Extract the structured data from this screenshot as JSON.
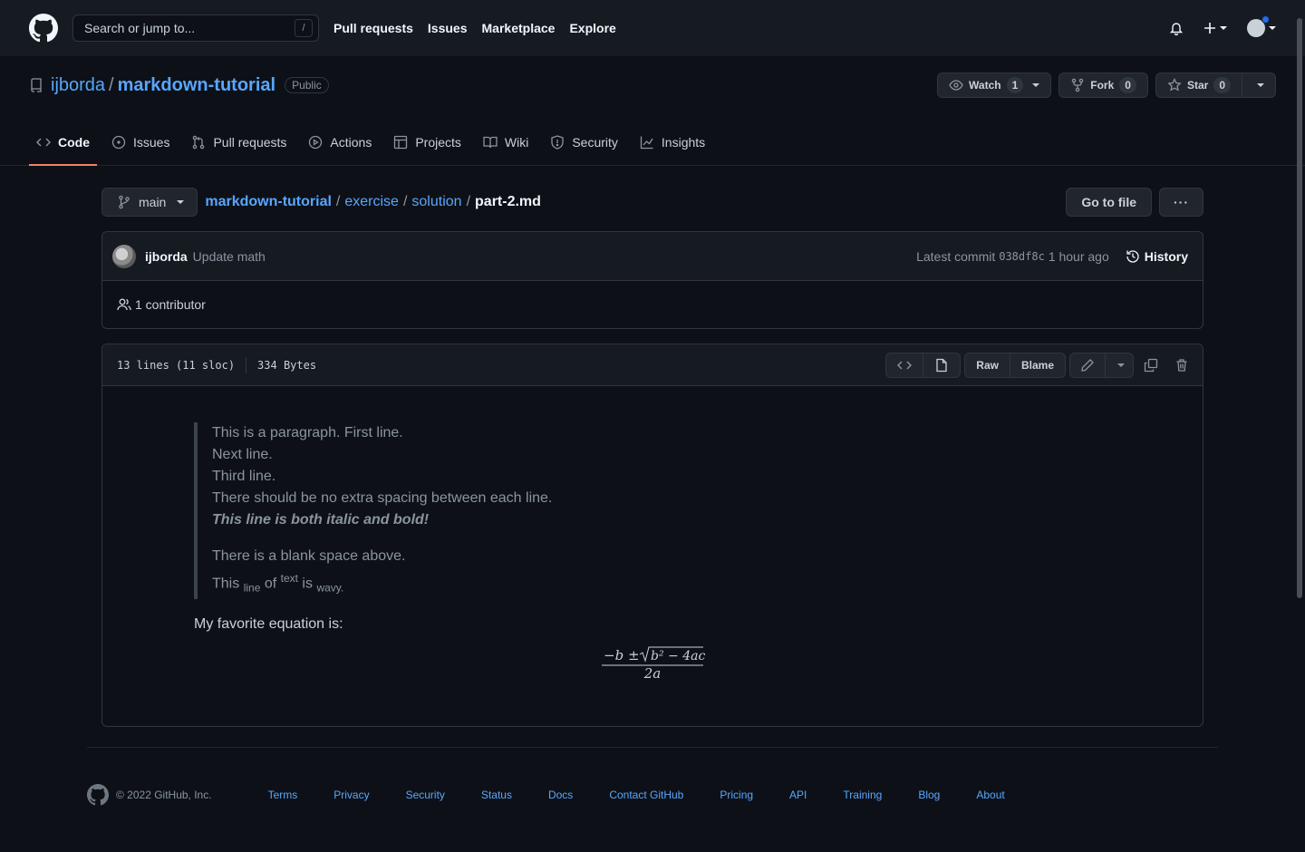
{
  "header": {
    "search_placeholder": "Search or jump to...",
    "search_shortcut": "/",
    "nav": [
      "Pull requests",
      "Issues",
      "Marketplace",
      "Explore"
    ]
  },
  "repo": {
    "owner": "ijborda",
    "separator": "/",
    "name": "markdown-tutorial",
    "visibility": "Public",
    "watch_label": "Watch",
    "watch_count": "1",
    "fork_label": "Fork",
    "fork_count": "0",
    "star_label": "Star",
    "star_count": "0",
    "tabs": [
      {
        "label": "Code",
        "icon": "code-icon",
        "active": true
      },
      {
        "label": "Issues",
        "icon": "issue-icon"
      },
      {
        "label": "Pull requests",
        "icon": "pull-request-icon"
      },
      {
        "label": "Actions",
        "icon": "play-icon"
      },
      {
        "label": "Projects",
        "icon": "table-icon"
      },
      {
        "label": "Wiki",
        "icon": "book-icon"
      },
      {
        "label": "Security",
        "icon": "shield-icon"
      },
      {
        "label": "Insights",
        "icon": "graph-icon"
      }
    ]
  },
  "file_nav": {
    "branch": "main",
    "path": [
      "markdown-tutorial",
      "exercise",
      "solution"
    ],
    "sep": "/",
    "file": "part-2.md",
    "go_to_file": "Go to file",
    "more": "···"
  },
  "commit": {
    "author": "ijborda",
    "message": "Update math",
    "latest_label": "Latest commit",
    "sha": "038df8c",
    "time": "1 hour ago",
    "history": "History",
    "contributors": "1 contributor"
  },
  "file": {
    "lines": "13 lines (11 sloc)",
    "size": "334 Bytes",
    "raw": "Raw",
    "blame": "Blame"
  },
  "content": {
    "quote_lines": [
      "This is a paragraph. First line.",
      "Next line.",
      "Third line.",
      "There should be no extra spacing between each line."
    ],
    "bold_italic": "This line is both italic and bold!",
    "blank_above": "There is a blank space above.",
    "wavy": {
      "w1": "This",
      "w2": "line",
      "w3": "of",
      "w4": "text",
      "w5": "is",
      "w6": "wavy."
    },
    "favorite": "My favorite equation is:",
    "equation": {
      "num_left": "−b ± ",
      "radicand": "b² − 4ac",
      "den": "2a"
    }
  },
  "footer": {
    "copyright": "© 2022 GitHub, Inc.",
    "links": [
      "Terms",
      "Privacy",
      "Security",
      "Status",
      "Docs",
      "Contact GitHub",
      "Pricing",
      "API",
      "Training",
      "Blog",
      "About"
    ]
  },
  "colors": {
    "bg": "#0d1117",
    "header_bg": "#161b22",
    "link": "#58a6ff",
    "active_tab_underline": "#f78166"
  }
}
